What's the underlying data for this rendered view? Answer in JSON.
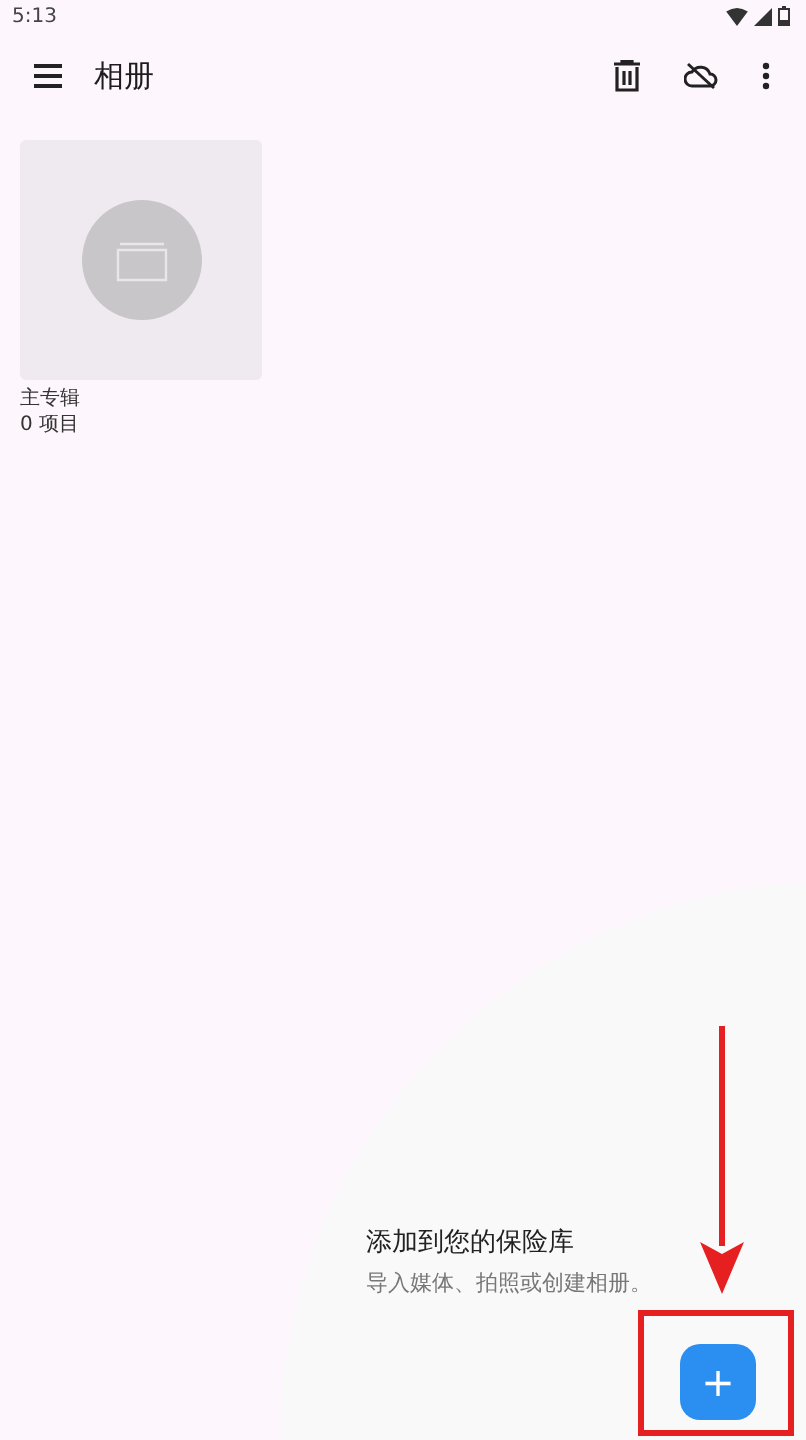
{
  "status_bar": {
    "time": "5:13"
  },
  "app_bar": {
    "title": "相册"
  },
  "albums": [
    {
      "name": "主专辑",
      "count": "0 项目"
    }
  ],
  "tip": {
    "title": "添加到您的保险库",
    "text": "导入媒体、拍照或创建相册。"
  },
  "fab": {
    "label": "+"
  }
}
